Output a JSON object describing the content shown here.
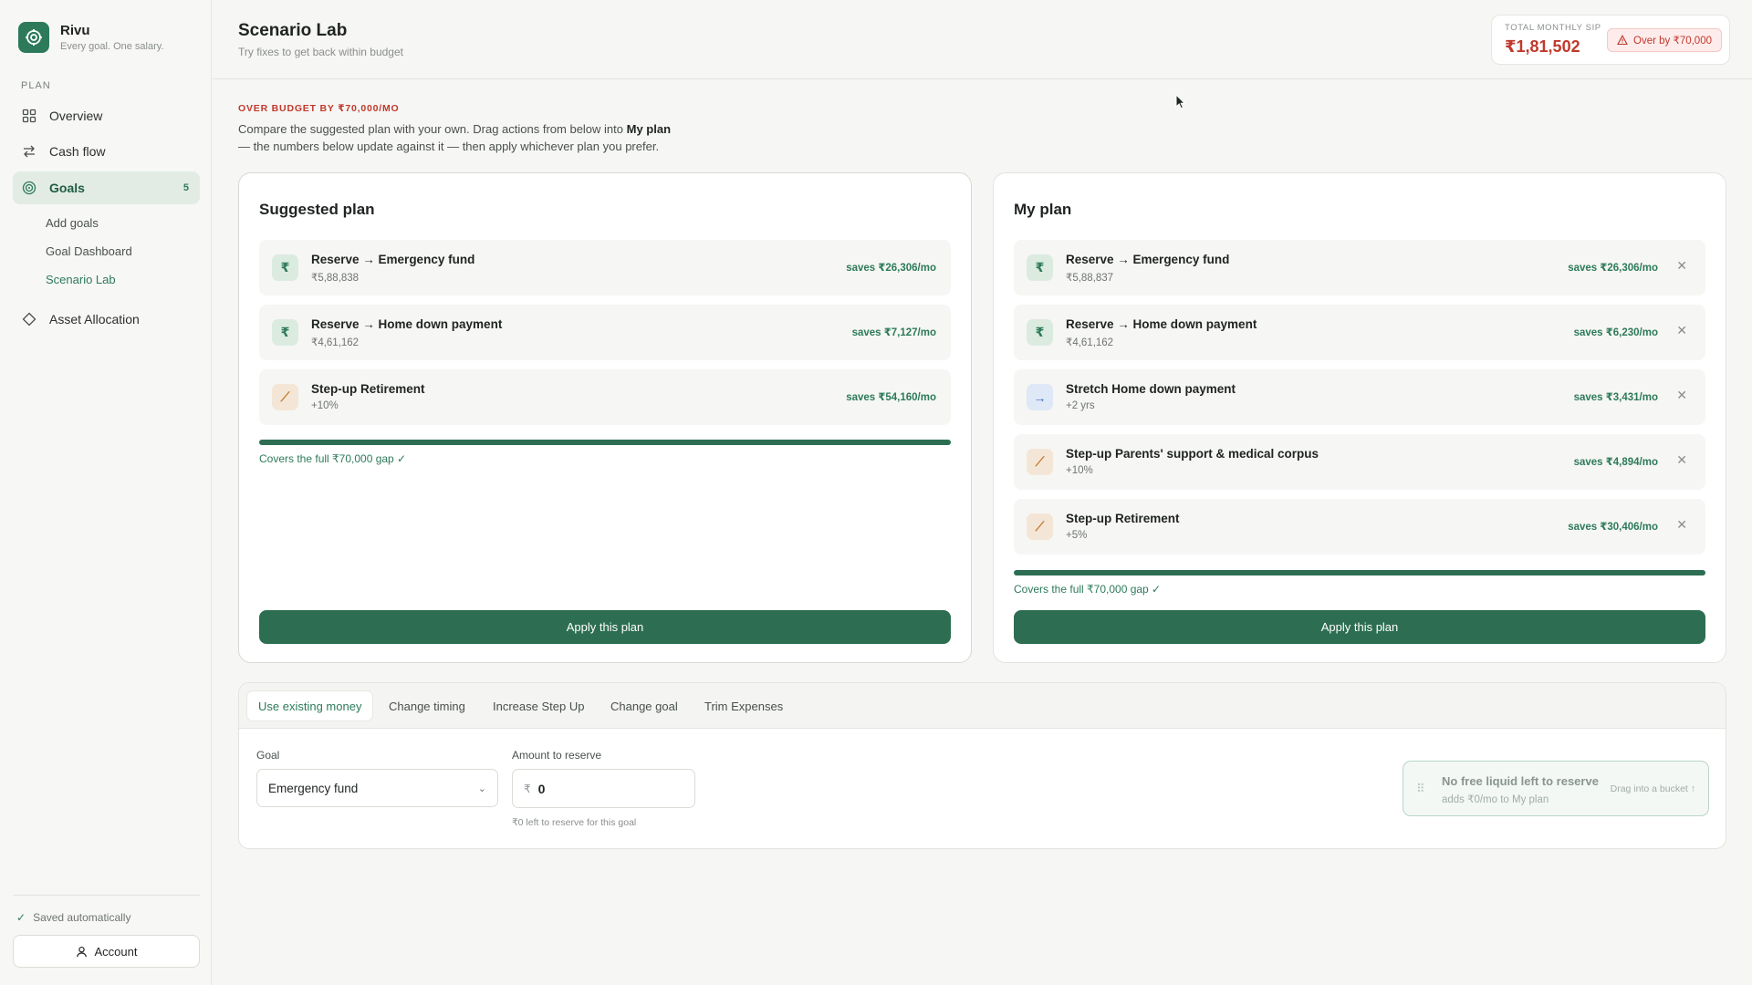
{
  "brand": {
    "name": "Rivu",
    "tagline": "Every goal. One salary."
  },
  "sidebar": {
    "section": "PLAN",
    "items": [
      {
        "label": "Overview",
        "icon": "grid-icon"
      },
      {
        "label": "Cash flow",
        "icon": "arrows-icon"
      },
      {
        "label": "Goals",
        "icon": "target-icon",
        "badge": "5"
      },
      {
        "label": "Asset Allocation",
        "icon": "diamond-icon"
      }
    ],
    "goals_sub": [
      "Add goals",
      "Goal Dashboard",
      "Scenario Lab"
    ],
    "saved": "Saved automatically",
    "account": "Account"
  },
  "header": {
    "title": "Scenario Lab",
    "subtitle": "Try fixes to get back within budget",
    "sip_label": "TOTAL MONTHLY SIP",
    "sip_value": "₹1,81,502",
    "over_badge": "Over by ₹70,000"
  },
  "intro": {
    "eyebrow": "OVER BUDGET BY ₹70,000/MO",
    "text_before": "Compare the suggested plan with your own. Drag actions from below into ",
    "text_bold": "My plan",
    "text_after": "— the numbers below update against it — then apply whichever plan you prefer."
  },
  "suggested": {
    "title": "Suggested plan",
    "rows": [
      {
        "title": "Reserve → Emergency fund",
        "sub": "₹5,88,838",
        "saves": "saves ₹26,306/mo",
        "icon": "rupee-icon",
        "tone": "green"
      },
      {
        "title": "Reserve → Home down payment",
        "sub": "₹4,61,162",
        "saves": "saves ₹7,127/mo",
        "icon": "rupee-icon",
        "tone": "green"
      },
      {
        "title": "Step-up Retirement",
        "sub": "+10%",
        "saves": "saves ₹54,160/mo",
        "icon": "stepup-icon",
        "tone": "orange"
      }
    ],
    "coverage": 1.0,
    "covers": "Covers the full ₹70,000 gap ✓",
    "apply": "Apply this plan"
  },
  "mine": {
    "title": "My plan",
    "rows": [
      {
        "title": "Reserve → Emergency fund",
        "sub": "₹5,88,837",
        "saves": "saves ₹26,306/mo",
        "icon": "rupee-icon",
        "tone": "green"
      },
      {
        "title": "Reserve → Home down payment",
        "sub": "₹4,61,162",
        "saves": "saves ₹6,230/mo",
        "icon": "rupee-icon",
        "tone": "green"
      },
      {
        "title": "Stretch Home down payment",
        "sub": "+2 yrs",
        "saves": "saves ₹3,431/mo",
        "icon": "arrow-right-icon",
        "tone": "blue"
      },
      {
        "title": "Step-up Parents' support & medical corpus",
        "sub": "+10%",
        "saves": "saves ₹4,894/mo",
        "icon": "stepup-icon",
        "tone": "orange"
      },
      {
        "title": "Step-up Retirement",
        "sub": "+5%",
        "saves": "saves ₹30,406/mo",
        "icon": "stepup-icon",
        "tone": "orange"
      }
    ],
    "coverage": 1.0,
    "covers": "Covers the full ₹70,000 gap ✓",
    "apply": "Apply this plan"
  },
  "actions": {
    "tabs": [
      "Use existing money",
      "Change timing",
      "Increase Step Up",
      "Change goal",
      "Trim Expenses"
    ],
    "goal_label": "Goal",
    "goal_value": "Emergency fund",
    "amount_label": "Amount to reserve",
    "currency": "₹",
    "amount_value": "0",
    "hint": "₹0 left to reserve for this goal",
    "drag_title": "No free liquid left to reserve",
    "drag_sub": "adds ₹0/mo to My plan",
    "drag_hint": "Drag into a bucket ↑"
  },
  "colors": {
    "accent": "#2d7a5b",
    "danger": "#c0392b",
    "button": "#2d6e52"
  }
}
